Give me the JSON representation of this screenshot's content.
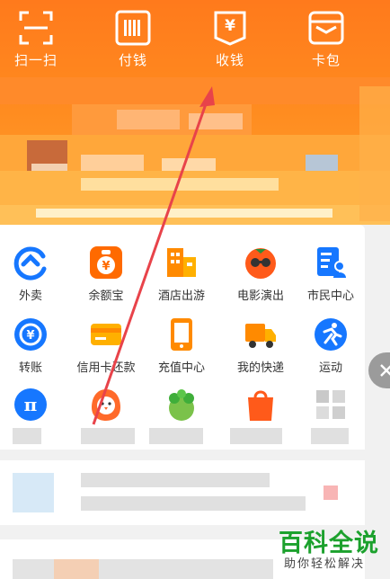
{
  "top_actions": [
    {
      "label": "扫一扫",
      "icon": "scan-icon"
    },
    {
      "label": "付钱",
      "icon": "barcode-icon"
    },
    {
      "label": "收钱",
      "icon": "yuan-receipt-icon"
    },
    {
      "label": "卡包",
      "icon": "card-wallet-icon"
    }
  ],
  "services_row1": [
    {
      "label": "外卖",
      "icon": "takeout-icon"
    },
    {
      "label": "余额宝",
      "icon": "yuebao-icon"
    },
    {
      "label": "酒店出游",
      "icon": "hotel-icon"
    },
    {
      "label": "电影演出",
      "icon": "movie-icon"
    },
    {
      "label": "市民中心",
      "icon": "citizen-center-icon"
    }
  ],
  "services_row2": [
    {
      "label": "转账",
      "icon": "transfer-icon"
    },
    {
      "label": "信用卡还款",
      "icon": "credit-card-icon"
    },
    {
      "label": "充值中心",
      "icon": "phone-recharge-icon"
    },
    {
      "label": "我的快递",
      "icon": "delivery-truck-icon"
    },
    {
      "label": "运动",
      "icon": "sport-icon"
    }
  ],
  "services_row3": [
    {
      "icon": "pi-icon"
    },
    {
      "icon": "chick-icon"
    },
    {
      "icon": "farm-icon"
    },
    {
      "icon": "shopping-bag-icon"
    },
    {
      "icon": "more-icon"
    }
  ],
  "watermark": {
    "title": "百科全说",
    "subtitle": "助你轻松解决"
  },
  "colors": {
    "accent": "#ff7a1c",
    "blue": "#1677ff",
    "orange": "#ff6a00",
    "arrow": "#e8434a"
  }
}
